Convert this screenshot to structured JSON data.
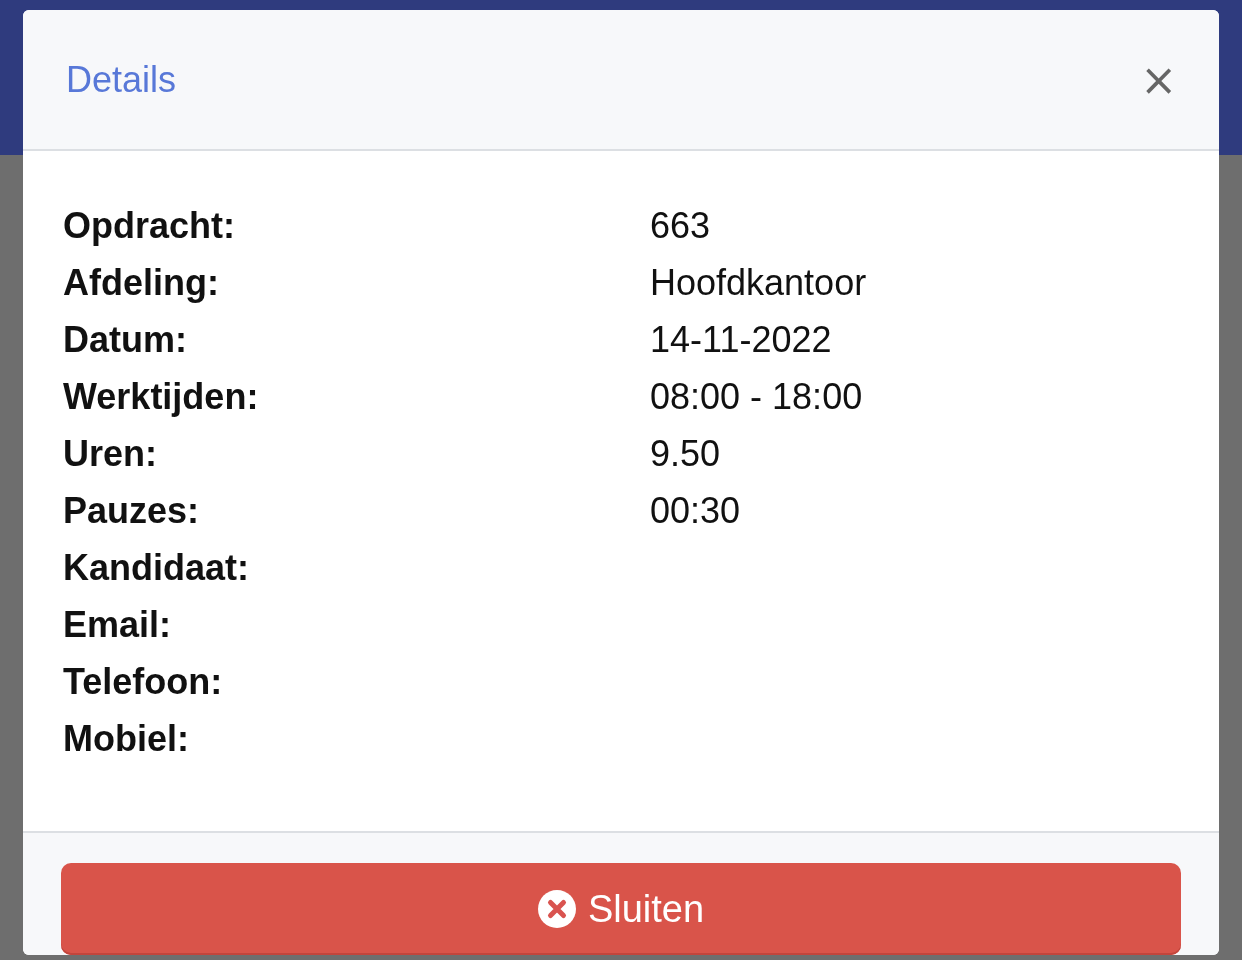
{
  "modal": {
    "title": "Details",
    "close_label": "×"
  },
  "details": [
    {
      "label": "Opdracht:",
      "value": "663"
    },
    {
      "label": "Afdeling:",
      "value": "Hoofdkantoor"
    },
    {
      "label": "Datum:",
      "value": "14-11-2022"
    },
    {
      "label": "Werktijden:",
      "value": "08:00 - 18:00"
    },
    {
      "label": "Uren:",
      "value": "9.50"
    },
    {
      "label": "Pauzes:",
      "value": "00:30"
    },
    {
      "label": "Kandidaat:"
    },
    {
      "label": "Email:"
    },
    {
      "label": "Telefoon:"
    },
    {
      "label": "Mobiel:"
    }
  ],
  "buttons": [
    {
      "label": "Sluiten",
      "kind": "close"
    }
  ]
}
